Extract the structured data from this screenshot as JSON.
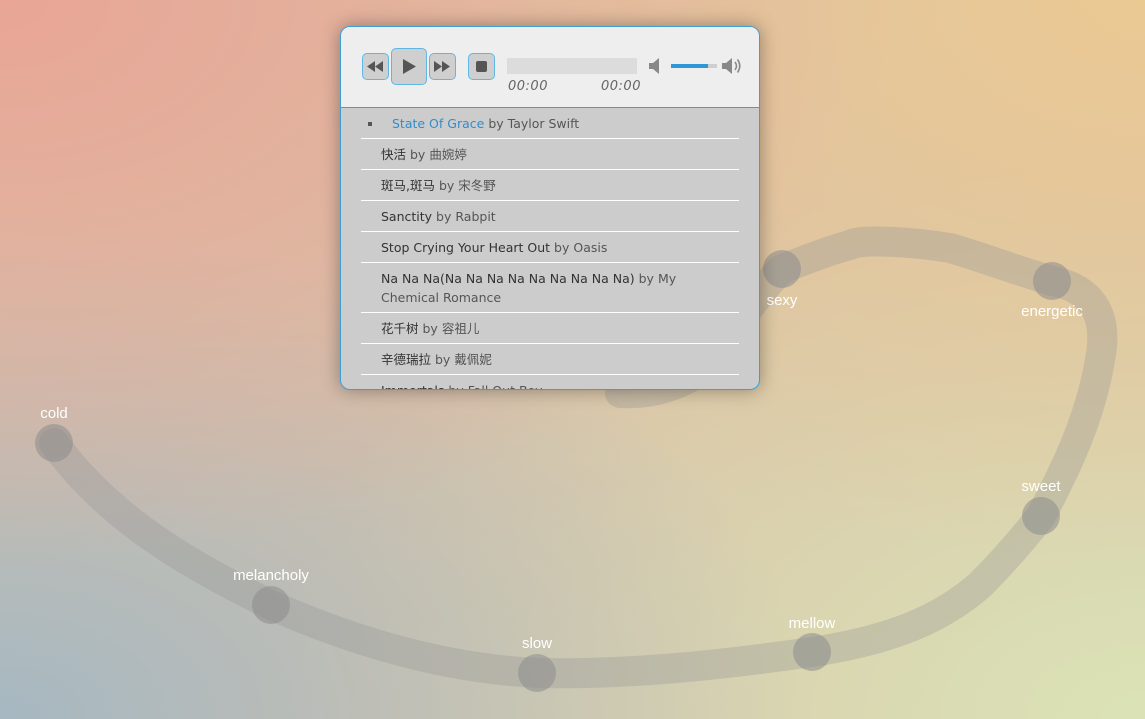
{
  "moods": [
    {
      "label": "cold"
    },
    {
      "label": "melancholy"
    },
    {
      "label": "slow"
    },
    {
      "label": "mellow"
    },
    {
      "label": "sweet"
    },
    {
      "label": "energetic"
    },
    {
      "label": "sexy"
    }
  ],
  "player": {
    "time_elapsed": "00:00",
    "time_total": "00:00",
    "progress": 0,
    "volume": 0.8,
    "accent_color": "#2e8ecf",
    "buttons": {
      "previous": "rewind-icon",
      "play": "play-icon",
      "next": "fast-forward-icon",
      "stop": "stop-icon",
      "mute": "speaker-mute-icon",
      "max_volume": "speaker-loud-icon"
    },
    "playlist": [
      {
        "title": "State Of Grace",
        "by": "by",
        "artist": "Taylor Swift",
        "current": true
      },
      {
        "title": "快活",
        "by": "by",
        "artist": "曲婉婷"
      },
      {
        "title": "斑马,斑马",
        "by": "by",
        "artist": "宋冬野"
      },
      {
        "title": "Sanctity",
        "by": "by",
        "artist": "Rabpit"
      },
      {
        "title": "Stop Crying Your Heart Out",
        "by": "by",
        "artist": "Oasis"
      },
      {
        "title": "Na Na Na(Na Na Na Na Na Na Na Na Na)",
        "by": "by",
        "artist": "My Chemical Romance"
      },
      {
        "title": "花千树",
        "by": "by",
        "artist": "容祖儿"
      },
      {
        "title": "辛德瑞拉",
        "by": "by",
        "artist": "戴佩妮"
      },
      {
        "title": "Immortals",
        "by": "by",
        "artist": "Fall Out Boy"
      }
    ]
  }
}
